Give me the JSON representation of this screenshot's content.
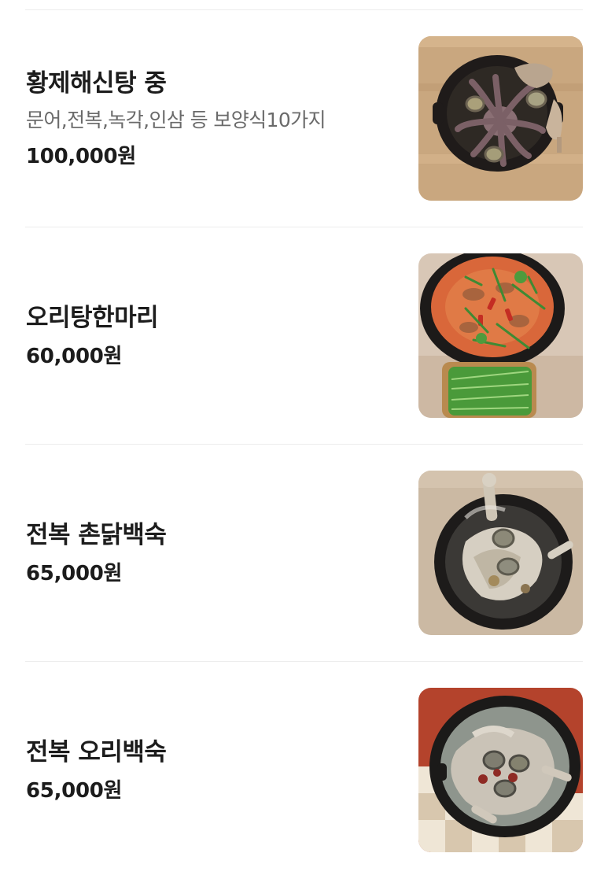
{
  "menu": {
    "items": [
      {
        "name": "황제해신탕 중",
        "description": "문어,전복,녹각,인삼 등 보양식10가지",
        "price": "100,000원",
        "photo_icon": "seafood-stew-photo"
      },
      {
        "name": "오리탕한마리",
        "description": "",
        "price": "60,000원",
        "photo_icon": "duck-stew-photo"
      },
      {
        "name": "전복 촌닭백숙",
        "description": "",
        "price": "65,000원",
        "photo_icon": "abalone-chicken-baeksuk-photo"
      },
      {
        "name": "전복 오리백숙",
        "description": "",
        "price": "65,000원",
        "photo_icon": "abalone-duck-baeksuk-photo"
      }
    ]
  }
}
